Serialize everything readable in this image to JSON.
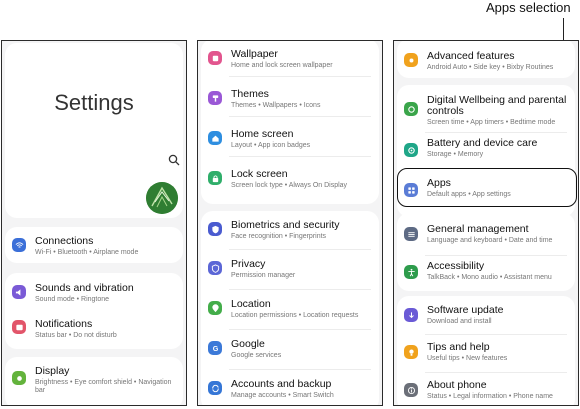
{
  "callout": {
    "label": "Apps selection"
  },
  "panel1": {
    "title": "Settings",
    "items": [
      {
        "title": "Connections",
        "subtitle": "Wi-Fi  •  Bluetooth  •  Airplane mode",
        "icon": "wifi-icon",
        "color": "#3b6fd8"
      },
      {
        "title": "Sounds and vibration",
        "subtitle": "Sound mode  •  Ringtone",
        "icon": "sound-icon",
        "color": "#7a5ad6"
      },
      {
        "title": "Notifications",
        "subtitle": "Status bar  •  Do not disturb",
        "icon": "notification-icon",
        "color": "#e2556a"
      },
      {
        "title": "Display",
        "subtitle": "Brightness  •  Eye comfort shield  •  Navigation",
        "subtitle2": "bar",
        "icon": "display-icon",
        "color": "#63b33c"
      }
    ]
  },
  "panel2": {
    "items": [
      {
        "title": "Wallpaper",
        "subtitle": "Home and lock screen wallpaper",
        "icon": "wallpaper-icon",
        "color": "#e2558e"
      },
      {
        "title": "Themes",
        "subtitle": "Themes  •  Wallpapers  •  Icons",
        "icon": "themes-icon",
        "color": "#9a58d6"
      },
      {
        "title": "Home screen",
        "subtitle": "Layout  •  App icon badges",
        "icon": "home-icon",
        "color": "#2e8ee0"
      },
      {
        "title": "Lock screen",
        "subtitle": "Screen lock type  •  Always On Display",
        "icon": "lock-icon",
        "color": "#2fae6a"
      },
      {
        "title": "Biometrics and security",
        "subtitle": "Face recognition  •  Fingerprints",
        "icon": "shield-icon",
        "color": "#4a5bd0"
      },
      {
        "title": "Privacy",
        "subtitle": "Permission manager",
        "icon": "privacy-icon",
        "color": "#5b66d6"
      },
      {
        "title": "Location",
        "subtitle": "Location permissions  •  Location requests",
        "icon": "location-icon",
        "color": "#43ad4a"
      },
      {
        "title": "Google",
        "subtitle": "Google services",
        "icon": "google-icon",
        "color": "#3b79d8"
      },
      {
        "title": "Accounts and backup",
        "subtitle": "Manage accounts  •  Smart Switch",
        "icon": "accounts-icon",
        "color": "#3576d6"
      }
    ]
  },
  "panel3": {
    "items": [
      {
        "title": "Advanced features",
        "subtitle": "Android Auto  •  Side key  •  Bixby Routines",
        "icon": "advanced-icon",
        "color": "#f0a21d"
      },
      {
        "title": "Digital Wellbeing and parental",
        "title2": "controls",
        "subtitle": "Screen time  •  App timers  •  Bedtime mode",
        "icon": "wellbeing-icon",
        "color": "#3aa54a"
      },
      {
        "title": "Battery and device care",
        "subtitle": "Storage  •  Memory",
        "icon": "battery-icon",
        "color": "#1fa688"
      },
      {
        "title": "Apps",
        "subtitle": "Default apps  •  App settings",
        "icon": "apps-icon",
        "color": "#5a7cd6"
      },
      {
        "title": "General management",
        "subtitle": "Language and keyboard  •  Date and time",
        "icon": "general-icon",
        "color": "#5d6a84"
      },
      {
        "title": "Accessibility",
        "subtitle": "TalkBack  •  Mono audio  •  Assistant menu",
        "icon": "accessibility-icon",
        "color": "#2e9c4c"
      },
      {
        "title": "Software update",
        "subtitle": "Download and install",
        "icon": "update-icon",
        "color": "#6a5ad6"
      },
      {
        "title": "Tips and help",
        "subtitle": "Useful tips  •  New features",
        "icon": "tips-icon",
        "color": "#f0a21d"
      },
      {
        "title": "About phone",
        "subtitle": "Status  •  Legal information  •  Phone name",
        "icon": "info-icon",
        "color": "#6b6f78"
      }
    ]
  }
}
